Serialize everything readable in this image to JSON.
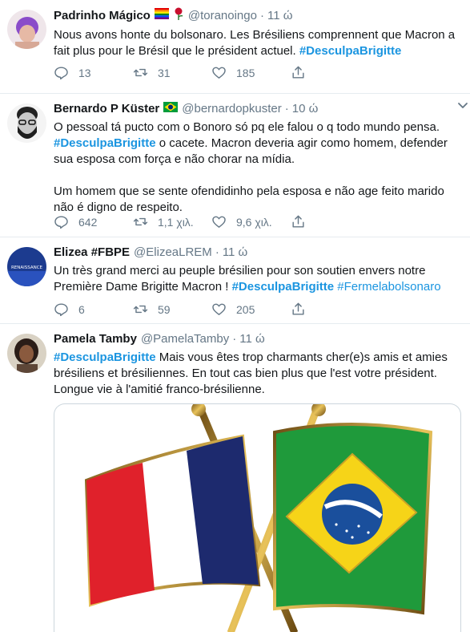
{
  "tweets": [
    {
      "name": "Padrinho Mágico",
      "handle": "@toranoingo",
      "dot": "·",
      "time": "11 ώ",
      "text_parts": [
        "Nous avons honte du bolsonaro. Les Brésiliens comprennent que Macron a fait plus pour le Brésil que le président actuel. ",
        "#DesculpaBrigitte"
      ],
      "replies": "13",
      "retweets": "31",
      "likes": "185"
    },
    {
      "name": "Bernardo P Küster",
      "handle": "@bernardopkuster",
      "dot": "·",
      "time": "10 ώ",
      "text_parts": [
        "O pessoal tá pucto com o Bonoro só pq ele falou o q todo mundo pensa. ",
        "#DesculpaBrigitte",
        " o cacete. Macron deveria agir como homem, defender sua esposa com força e não chorar na mídia."
      ],
      "text_para2": "Um homem que se sente ofendidinho pela esposa e não age feito marido não é digno de respeito.",
      "replies": "642",
      "retweets": "1,1 χιλ.",
      "likes": "9,6 χιλ."
    },
    {
      "name": "Elizea #FBPE",
      "handle": "@ElizeaLREM",
      "dot": "·",
      "time": "11 ώ",
      "avatar_text": "RENAISSANCE",
      "text_parts": [
        "Un très grand merci au peuple brésilien pour son soutien envers notre Première Dame Brigitte Macron ! ",
        "#DesculpaBrigitte",
        " ",
        "#Fermelabolsonaro"
      ],
      "replies": "6",
      "retweets": "59",
      "likes": "205"
    },
    {
      "name": "Pamela Tamby",
      "handle": "@PamelaTamby",
      "dot": "·",
      "time": "11 ώ",
      "text_parts": [
        "#DesculpaBrigitte",
        " Mais vous êtes trop charmants cher(e)s amis et amies brésiliens et brésiliennes. En tout cas bien plus que l'est votre président. Longue vie à l'amitié franco-brésilienne."
      ]
    }
  ],
  "colors": {
    "link": "#1b95e0",
    "secondary": "#657786",
    "border": "#e6ecf0"
  },
  "icons": [
    "reply-icon",
    "retweet-icon",
    "like-icon",
    "share-icon",
    "caret-down-icon"
  ]
}
